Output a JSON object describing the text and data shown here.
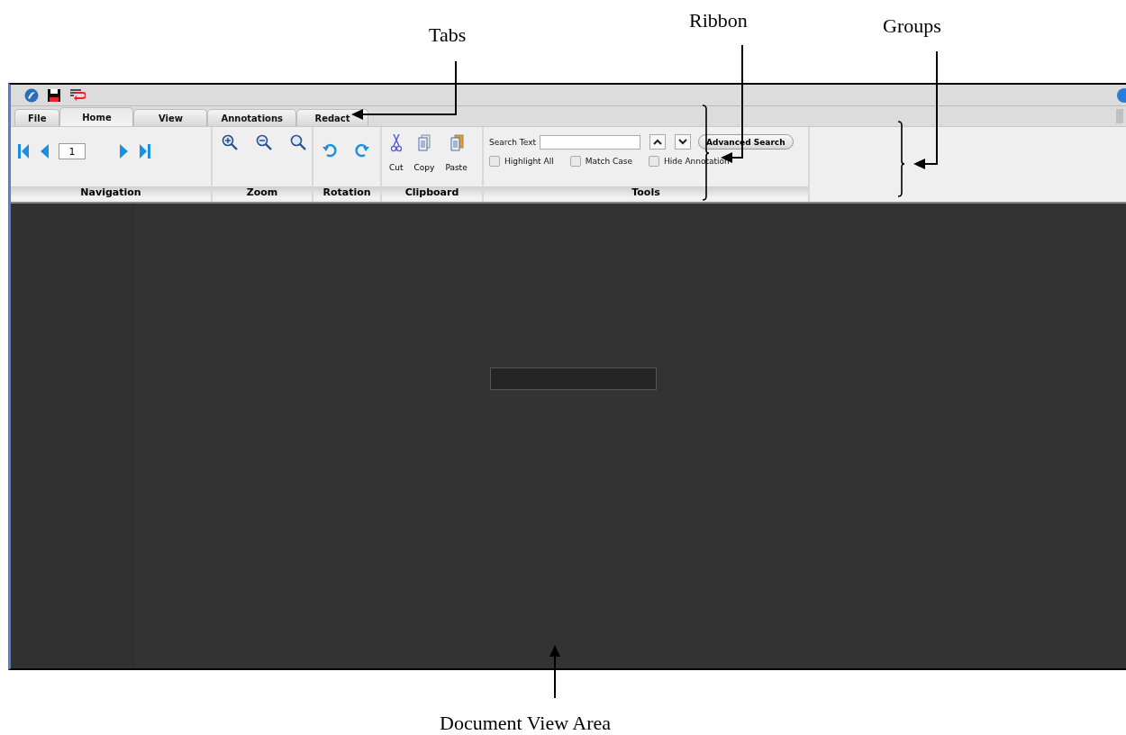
{
  "callouts": [
    {
      "kind": "tabs",
      "label": "Tabs"
    },
    {
      "kind": "ribbon",
      "label": "Ribbon"
    },
    {
      "kind": "groups",
      "label": "Groups"
    },
    {
      "kind": "document",
      "label": "Document View Area"
    }
  ],
  "tabs": [
    {
      "label": "File",
      "selected": false
    },
    {
      "label": "Home",
      "selected": true
    },
    {
      "label": "View",
      "selected": false
    },
    {
      "label": "Annotations",
      "selected": false
    },
    {
      "label": "Redact",
      "selected": false
    }
  ],
  "groups": [
    {
      "kind": "navigation",
      "label": "Navigation",
      "page": "1"
    },
    {
      "kind": "zoom",
      "label": "Zoom"
    },
    {
      "kind": "rotation",
      "label": "Rotation"
    },
    {
      "kind": "clipboard",
      "label": "Clipboard",
      "buttons": [
        "Cut",
        "Copy",
        "Paste"
      ]
    },
    {
      "kind": "tools",
      "label": "Tools",
      "search_label": "Search Text",
      "button": "Advanced Search",
      "options": [
        {
          "label": "Highlight All",
          "checked": false
        },
        {
          "label": "Match Case",
          "checked": false
        },
        {
          "label": "Hide Annotation",
          "checked": false
        }
      ]
    }
  ]
}
